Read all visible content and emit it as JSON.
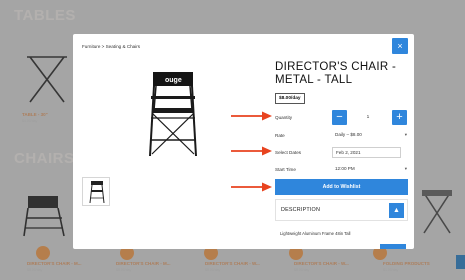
{
  "background": {
    "sections": {
      "tables": "TABLES",
      "chairs": "CHAIRS"
    },
    "product_captions": [
      {
        "name": "TABLE - 30\"",
        "price": "$4.00/day"
      },
      {
        "name": "DIRECTOR'S CHAIR - M...",
        "price": "$8.00/day"
      },
      {
        "name": "DIRECTOR'S CHAIR - M...",
        "price": "$8.00/day"
      },
      {
        "name": "DIRECTOR'S CHAIR - W...",
        "price": "$8.00/day"
      },
      {
        "name": "DIRECTOR'S CHAIR - W...",
        "price": "$8.00/day"
      },
      {
        "name": "FOLDING PRODUCTS",
        "price": "$1.00/day"
      }
    ]
  },
  "modal": {
    "breadcrumb": "Furniture > Seating & Chairs",
    "close_icon": "×",
    "product": {
      "title": "DIRECTOR'S CHAIR - METAL - TALL",
      "price_badge": "$8.00/day",
      "chair_back_text": "ouge"
    },
    "form": {
      "quantity_label": "Quantity",
      "minus_icon": "−",
      "plus_icon": "+",
      "quantity_value": "1",
      "rate_label": "Rate",
      "rate_value": "Daily – $8.00",
      "select_dates_label": "Select Dates",
      "date_value": "Feb 2, 2021",
      "start_time_label": "Start Time",
      "start_time_value": "12:00 PM",
      "caret_icon": "▾",
      "wishlist_button": "Add to Wishlist"
    },
    "description": {
      "label": "DESCRIPTION",
      "toggle_icon": "▲",
      "text": "Lightweight Aluminum Frame 48in Tall"
    }
  },
  "colors": {
    "accent": "#2f86dc",
    "annotation_arrow": "#e8431f",
    "background_caption": "#e2a272"
  }
}
